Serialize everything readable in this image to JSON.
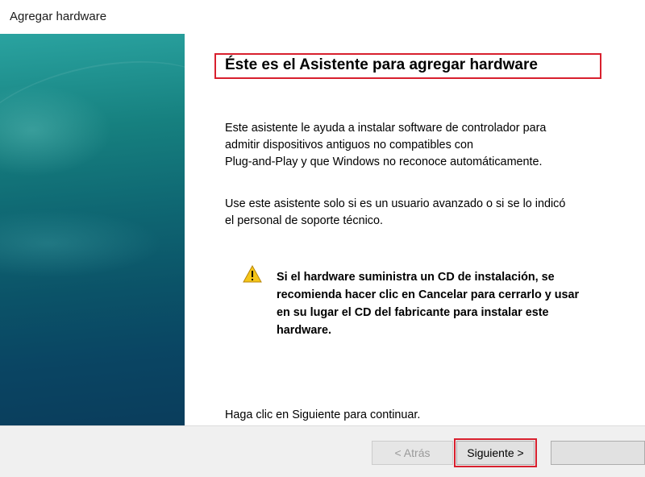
{
  "window": {
    "title": "Agregar hardware"
  },
  "wizard": {
    "heading": "Éste es el Asistente para agregar hardware",
    "intro_line1": "Este asistente le ayuda a instalar software de controlador para",
    "intro_line2": "admitir dispositivos antiguos no compatibles con",
    "intro_line3": "Plug-and-Play y que Windows no reconoce automáticamente.",
    "advanced_line1": "Use este asistente solo si es un usuario avanzado o si se lo indicó",
    "advanced_line2": "el personal de soporte técnico.",
    "warning_icon": "warning-icon",
    "warning_line1": "Si el hardware suministra un CD de instalación, se",
    "warning_line2": "recomienda hacer clic en Cancelar para cerrarlo y usar",
    "warning_line3": "en su lugar el CD del fabricante para instalar este",
    "warning_line4": "hardware.",
    "continue_text": "Haga clic en Siguiente para continuar."
  },
  "buttons": {
    "back_label": "< Atrás",
    "next_label": "Siguiente >",
    "cancel_label": ""
  },
  "colors": {
    "highlight": "#d8202e",
    "sidebar_top": "#2aa3a0",
    "sidebar_bottom": "#0a3d5c"
  }
}
